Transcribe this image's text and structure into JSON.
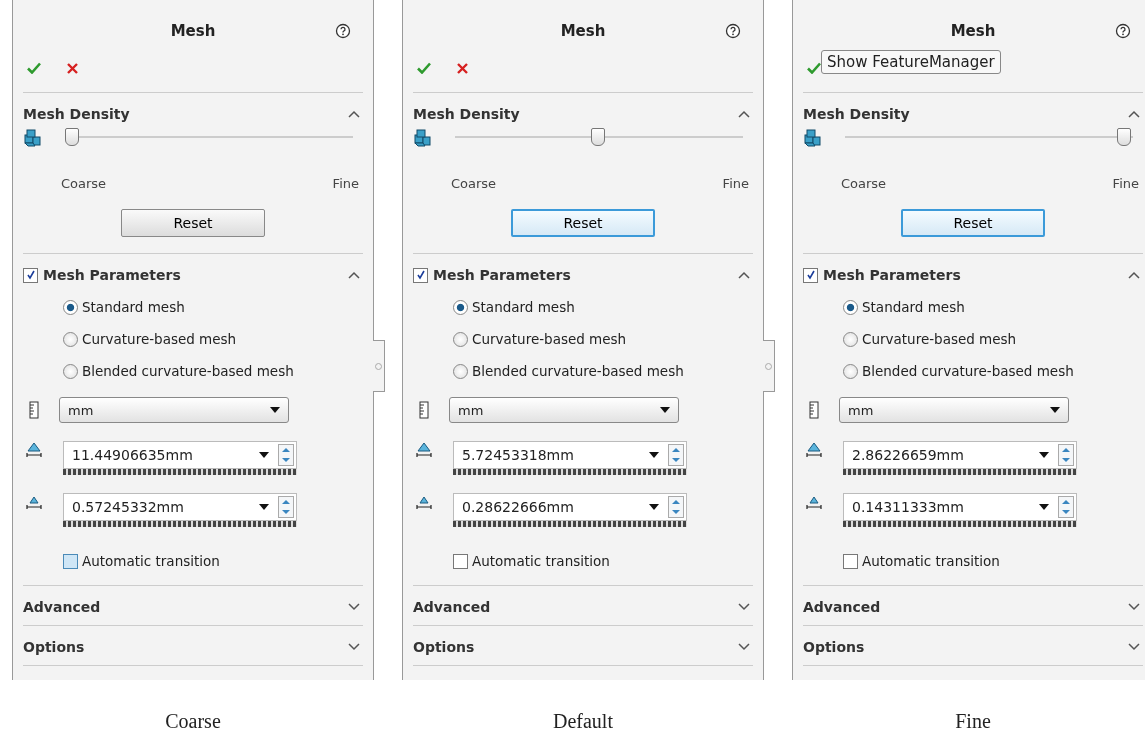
{
  "panels": [
    {
      "caption": "Coarse",
      "title": "Mesh",
      "density": {
        "title": "Mesh Density",
        "expanded": true,
        "level": 0,
        "min_label": "Coarse",
        "max_label": "Fine",
        "reset": "Reset",
        "reset_focused": false
      },
      "parameters": {
        "title": "Mesh Parameters",
        "checked": true,
        "expanded": true,
        "options": [
          {
            "label": "Standard mesh",
            "selected": true
          },
          {
            "label": "Curvature-based mesh",
            "selected": false
          },
          {
            "label": "Blended curvature-based mesh",
            "selected": false
          }
        ],
        "unit": "mm",
        "element_size": "11.44906635mm",
        "tolerance": "0.57245332mm",
        "auto_transition": {
          "label": "Automatic transition",
          "checked": false,
          "hovered": true
        }
      },
      "sections": [
        {
          "title": "Advanced",
          "expanded": false
        },
        {
          "title": "Options",
          "expanded": false
        }
      ]
    },
    {
      "caption": "Default",
      "title": "Mesh",
      "density": {
        "title": "Mesh Density",
        "expanded": true,
        "level": 0.5,
        "min_label": "Coarse",
        "max_label": "Fine",
        "reset": "Reset",
        "reset_focused": true
      },
      "parameters": {
        "title": "Mesh Parameters",
        "checked": true,
        "expanded": true,
        "options": [
          {
            "label": "Standard mesh",
            "selected": true
          },
          {
            "label": "Curvature-based mesh",
            "selected": false
          },
          {
            "label": "Blended curvature-based mesh",
            "selected": false
          }
        ],
        "unit": "mm",
        "element_size": "5.72453318mm",
        "tolerance": "0.28622666mm",
        "auto_transition": {
          "label": "Automatic transition",
          "checked": false,
          "hovered": false
        }
      },
      "sections": [
        {
          "title": "Advanced",
          "expanded": false
        },
        {
          "title": "Options",
          "expanded": false
        }
      ]
    },
    {
      "caption": "Fine",
      "title": "Mesh",
      "tooltip": "Show FeatureManager",
      "density": {
        "title": "Mesh Density",
        "expanded": true,
        "level": 1,
        "min_label": "Coarse",
        "max_label": "Fine",
        "reset": "Reset",
        "reset_focused": true
      },
      "parameters": {
        "title": "Mesh Parameters",
        "checked": true,
        "expanded": true,
        "options": [
          {
            "label": "Standard mesh",
            "selected": true
          },
          {
            "label": "Curvature-based mesh",
            "selected": false
          },
          {
            "label": "Blended curvature-based mesh",
            "selected": false
          }
        ],
        "unit": "mm",
        "element_size": "2.86226659mm",
        "tolerance": "0.14311333mm",
        "auto_transition": {
          "label": "Automatic transition",
          "checked": false,
          "hovered": false
        }
      },
      "sections": [
        {
          "title": "Advanced",
          "expanded": false
        },
        {
          "title": "Options",
          "expanded": false
        }
      ]
    }
  ]
}
